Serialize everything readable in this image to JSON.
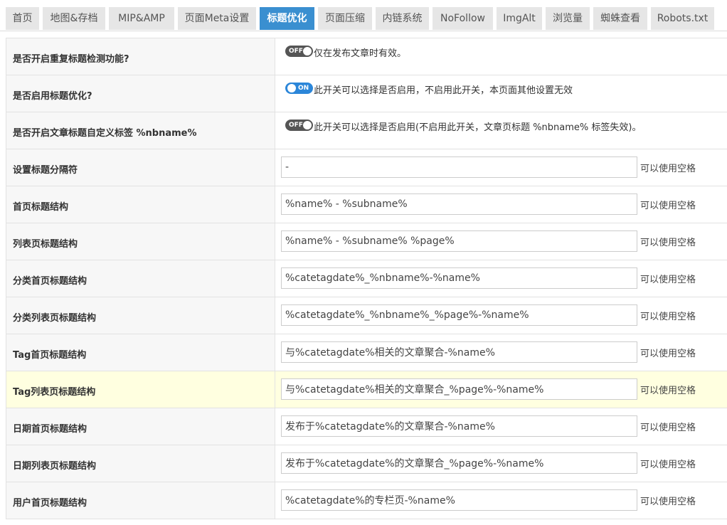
{
  "tabs": [
    {
      "label": "首页"
    },
    {
      "label": "地图&存档"
    },
    {
      "label": "MIP&AMP"
    },
    {
      "label": "页面Meta设置"
    },
    {
      "label": "标题优化"
    },
    {
      "label": "页面压缩"
    },
    {
      "label": "内链系统"
    },
    {
      "label": "NoFollow"
    },
    {
      "label": "ImgAlt"
    },
    {
      "label": "浏览量"
    },
    {
      "label": "蜘蛛查看"
    },
    {
      "label": "Robots.txt"
    }
  ],
  "active_tab": "标题优化",
  "settings": {
    "dup_check": {
      "label": "是否开启重复标题检测功能?",
      "switch_text": "OFF",
      "state": "off",
      "description": "仅在发布文章时有效。"
    },
    "enable_opt": {
      "label": "是否启用标题优化?",
      "switch_text": "ON",
      "state": "on",
      "description": "此开关可以选择是否启用，不启用此开关，本页面其他设置无效"
    },
    "custom_tag": {
      "label": "是否开启文章标题自定义标签 %nbname%",
      "switch_text": "OFF",
      "state": "off",
      "description": "此开关可以选择是否启用(不启用此开关，文章页标题 %nbname% 标签失效)。"
    }
  },
  "fields": [
    {
      "label": "设置标题分隔符",
      "value": "-",
      "hint": "可以使用空格"
    },
    {
      "label": "首页标题结构",
      "value": "%name% - %subname%",
      "hint": "可以使用空格"
    },
    {
      "label": "列表页标题结构",
      "value": "%name% - %subname% %page%",
      "hint": "可以使用空格"
    },
    {
      "label": "分类首页标题结构",
      "value": "%catetagdate%_%nbname%-%name%",
      "hint": "可以使用空格"
    },
    {
      "label": "分类列表页标题结构",
      "value": "%catetagdate%_%nbname%_%page%-%name%",
      "hint": "可以使用空格"
    },
    {
      "label": "Tag首页标题结构",
      "value": "与%catetagdate%相关的文章聚合-%name%",
      "hint": "可以使用空格"
    },
    {
      "label": "Tag列表页标题结构",
      "value": "与%catetagdate%相关的文章聚合_%page%-%name%",
      "hint": "可以使用空格"
    },
    {
      "label": "日期首页标题结构",
      "value": "发布于%catetagdate%的文章聚合-%name%",
      "hint": "可以使用空格"
    },
    {
      "label": "日期列表页标题结构",
      "value": "发布于%catetagdate%的文章聚合_%page%-%name%",
      "hint": "可以使用空格"
    },
    {
      "label": "用户首页标题结构",
      "value": "%catetagdate%的专栏页-%name%",
      "hint": "可以使用空格"
    }
  ],
  "colors": {
    "active_tab": "#3a8fd0",
    "tab_bg": "#e6e6e6",
    "switch_on": "#2b86d9",
    "switch_off": "#555555",
    "row_highlight": "#ffffe0"
  }
}
